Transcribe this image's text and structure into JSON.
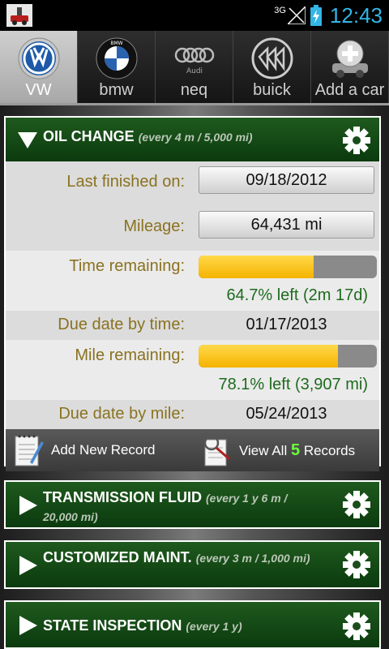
{
  "status": {
    "network": "3G",
    "time": "12:43"
  },
  "tabs": [
    {
      "label": "VW",
      "logo": "vw-logo",
      "active": true
    },
    {
      "label": "bmw",
      "logo": "bmw-logo",
      "active": false
    },
    {
      "label": "neq",
      "logo": "audi-logo",
      "active": false
    },
    {
      "label": "buick",
      "logo": "buick-logo",
      "active": false
    },
    {
      "label": "Add a car",
      "logo": "add-car-icon",
      "active": false
    }
  ],
  "oil": {
    "title": "OIL CHANGE",
    "interval": "(every 4 m / 5,000 mi)",
    "last_finished_label": "Last finished on:",
    "last_finished_value": "09/18/2012",
    "mileage_label": "Mileage:",
    "mileage_value": "64,431 mi",
    "time_label": "Time remaining:",
    "time_fraction": 0.647,
    "time_pct_text": "64.7% left (2m 17d)",
    "due_time_label": "Due date by time:",
    "due_time_value": "01/17/2013",
    "mile_label": "Mile remaining:",
    "mile_fraction": 0.781,
    "mile_pct_text": "78.1% left (3,907 mi)",
    "due_mile_label": "Due date by mile:",
    "due_mile_value": "05/24/2013",
    "add_record": "Add New Record",
    "view_all_prefix": "View All",
    "view_all_count": "5",
    "view_all_suffix": "Records"
  },
  "cards": [
    {
      "title": "TRANSMISSION FLUID",
      "interval": "(every 1 y 6 m / 20,000 mi)"
    },
    {
      "title": "CUSTOMIZED MAINT.",
      "interval": "(every 3 m / 1,000 mi)"
    },
    {
      "title": "STATE INSPECTION",
      "interval": "(every 1 y)"
    }
  ],
  "colors": {
    "accent": "#33b5e5",
    "header_green": "#0b3a0e",
    "progress": "#f5b300",
    "pct_text": "#1e6b1e",
    "count": "#6cff3c"
  }
}
